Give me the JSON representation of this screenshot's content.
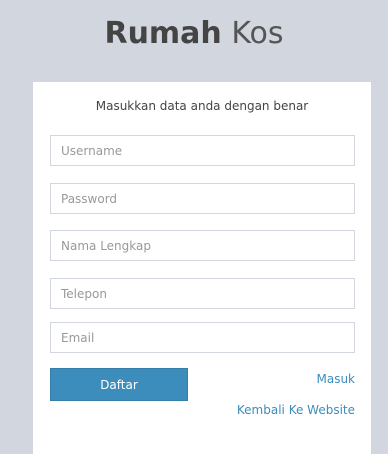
{
  "logo": {
    "bold": "Rumah",
    "light": "Kos"
  },
  "form": {
    "message": "Masukkan data anda dengan benar",
    "username_placeholder": "Username",
    "password_placeholder": "Password",
    "fullname_placeholder": "Nama Lengkap",
    "phone_placeholder": "Telepon",
    "email_placeholder": "Email",
    "submit_label": "Daftar",
    "login_link": "Masuk",
    "back_link": "Kembali Ke Website"
  },
  "colors": {
    "background": "#d2d6de",
    "accent": "#3c8dbc",
    "box": "#ffffff"
  }
}
